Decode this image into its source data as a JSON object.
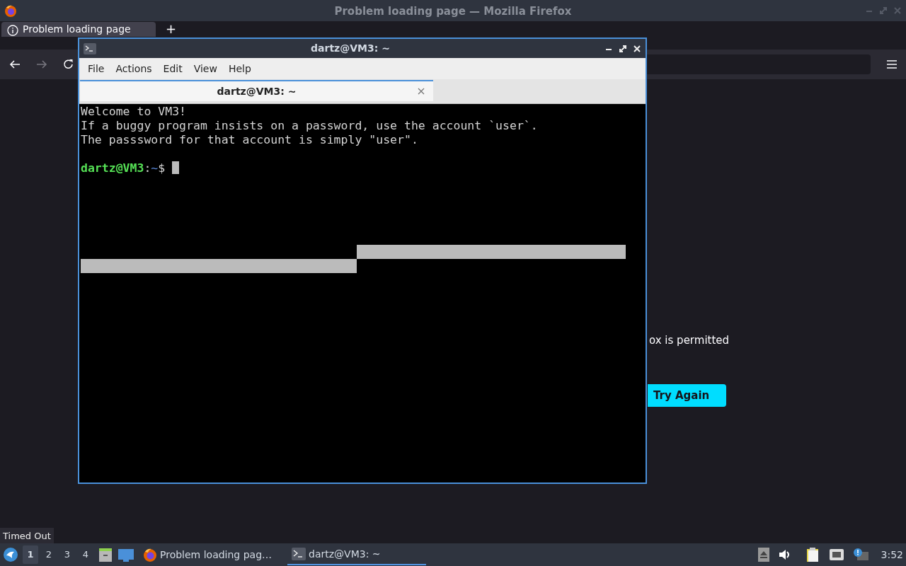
{
  "firefox": {
    "title": "Problem loading page — Mozilla Firefox",
    "tabs": [
      {
        "label": "Problem loading page",
        "selected": true
      }
    ],
    "new_tab": "+",
    "page": {
      "message_fragment": "ox is permitted",
      "button": "Try Again"
    }
  },
  "terminal": {
    "title": "dartz@VM3: ~",
    "menu": [
      "File",
      "Actions",
      "Edit",
      "View",
      "Help"
    ],
    "tabs": [
      {
        "label": "dartz@VM3: ~",
        "selected": true
      }
    ],
    "lines": [
      "Welcome to VM3!",
      "If a buggy program insists on a password, use the account `user`.",
      "The passsword for that account is simply \"user\"."
    ],
    "prompt": {
      "user_host": "dartz@VM3",
      "separator": ":",
      "path": "~",
      "symbol": "$"
    }
  },
  "tooltip": "Timed Out",
  "taskbar": {
    "workspaces": [
      {
        "label": "1",
        "selected": true
      },
      {
        "label": "2",
        "selected": false
      },
      {
        "label": "3",
        "selected": false
      },
      {
        "label": "4",
        "selected": false
      }
    ],
    "tasks": [
      {
        "kind": "firefox",
        "label": "Problem loading pag…",
        "selected": false
      },
      {
        "kind": "terminal",
        "label": "dartz@VM3: ~",
        "selected": true
      }
    ],
    "clock": "3:52"
  }
}
